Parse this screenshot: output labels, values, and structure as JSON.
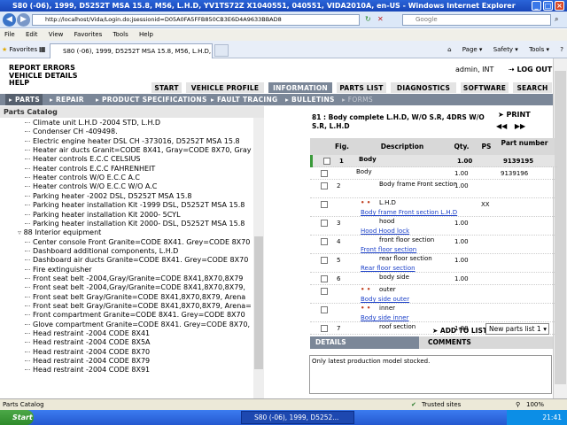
{
  "window": {
    "title": "S80 (-06), 1999, D5252T MSA 15.8, M56, L.H.D, YV1TS72Z X1040551, 040551, VIDA2010A, en-US - Windows Internet Explorer",
    "address": "http://localhost/Vida/Login.do;jsessionid=D05A0FA5FFB850CB3E6D4A9633BBAD8",
    "search_placeholder": "Google",
    "menu": [
      "File",
      "Edit",
      "View",
      "Favorites",
      "Tools",
      "Help"
    ],
    "favorites_label": "Favorites",
    "tab_title": "S80 (-06), 1999, D5252T MSA 15.8, M56, L.H.D, YV1...",
    "page_tools": [
      "Page ▾",
      "Safety ▾",
      "Tools ▾",
      "?"
    ]
  },
  "header": {
    "links": [
      "REPORT ERRORS",
      "VEHICLE DETAILS",
      "HELP"
    ],
    "user": "admin, INT",
    "logout": "LOG OUT"
  },
  "main_tabs": [
    "START",
    "VEHICLE PROFILE",
    "INFORMATION",
    "PARTS LIST",
    "DIAGNOSTICS",
    "SOFTWARE",
    "SEARCH"
  ],
  "sub_nav": [
    "PARTS",
    "REPAIR",
    "PRODUCT SPECIFICATIONS",
    "FAULT TRACING",
    "BULLETINS",
    "FORMS"
  ],
  "catalog": {
    "title": "Parts Catalog",
    "items": [
      {
        "text": "Climate unit L.H.D -2004 STD, L.H.D"
      },
      {
        "text": "Condenser CH -409498."
      },
      {
        "text": "Electric engine heater DSL CH -373016, D5252T MSA 15.8"
      },
      {
        "text": "Heater air ducts Granit=CODE 8X41, Gray=CODE 8X70, Gray"
      },
      {
        "text": "Heater controls E.C.C CELSIUS"
      },
      {
        "text": "Heater controls E.C.C FAHRENHEIT"
      },
      {
        "text": "Heater controls W/O E.C.C A.C"
      },
      {
        "text": "Heater controls W/O E.C.C W/O A.C"
      },
      {
        "text": "Parking heater -2002 DSL, D5252T MSA 15.8"
      },
      {
        "text": "Parking heater installation Kit -1999 DSL, D5252T MSA 15.8"
      },
      {
        "text": "Parking heater installation Kit 2000- 5CYL"
      },
      {
        "text": "Parking heater installation Kit 2000- DSL, D5252T MSA 15.8"
      },
      {
        "text": "88 Interior equipment",
        "group": true
      },
      {
        "text": "Center console Front Granite=CODE 8X41. Grey=CODE 8X70"
      },
      {
        "text": "Dashboard additional components, L.H.D"
      },
      {
        "text": "Dashboard air ducts Granite=CODE 8X41. Grey=CODE 8X70"
      },
      {
        "text": "Fire extinguisher"
      },
      {
        "text": "Front seat belt -2004,Gray/Granite=CODE 8X41,8X70,8X79"
      },
      {
        "text": "Front seat belt -2004,Gray/Granite=CODE 8X41,8X70,8X79,"
      },
      {
        "text": "Front seat belt Gray/Granite=CODE 8X41,8X70,8X79, Arena"
      },
      {
        "text": "Front seat belt Gray/Granite=CODE 8X41,8X70,8X79, Arena="
      },
      {
        "text": "Front compartment Granite=CODE 8X41. Grey=CODE 8X70"
      },
      {
        "text": "Glove compartment Granite=CODE 8X41. Grey=CODE 8X70,"
      },
      {
        "text": "Head restraint -2004 CODE 8X41"
      },
      {
        "text": "Head restraint -2004 CODE 8X5A"
      },
      {
        "text": "Head restraint -2004 CODE 8X70"
      },
      {
        "text": "Head restraint -2004 CODE 8X79"
      },
      {
        "text": "Head restraint -2004 CODE 8X91"
      }
    ]
  },
  "assembly": {
    "title": "81 : Body complete L.H.D, W/O S.R, 4DRS W/O S.R, L.H.D",
    "print": "PRINT"
  },
  "parts_table": {
    "headers": [
      "Fig.",
      "Description",
      "Qty.",
      "PS",
      "Part number"
    ],
    "rows": [
      {
        "fig": "1",
        "desc": "Body",
        "qty": "1.00",
        "ps": "",
        "pn": "9139195",
        "bold": true
      },
      {
        "fig": "",
        "desc": "Body",
        "qty": "1.00",
        "ps": "",
        "pn": "9139196"
      },
      {
        "fig": "2",
        "desc": "Body frame Front section",
        "qty": "1.00",
        "ps": "",
        "pn": ""
      },
      {
        "stars": "• •",
        "desc": "L.H.D",
        "qty": "",
        "ps": "XX",
        "pn": "",
        "link": "Body frame Front section L.H.D"
      },
      {
        "fig": "3",
        "desc": "hood",
        "qty": "1.00",
        "ps": "",
        "pn": "",
        "link": "Hood Hood lock"
      },
      {
        "fig": "4",
        "desc": "front floor section",
        "qty": "1.00",
        "ps": "",
        "pn": "",
        "link": "Front floor section"
      },
      {
        "fig": "5",
        "desc": "rear floor section",
        "qty": "1.00",
        "ps": "",
        "pn": "",
        "link": "Rear floor section"
      },
      {
        "fig": "6",
        "desc": "body side",
        "qty": "1.00",
        "ps": "",
        "pn": ""
      },
      {
        "stars": "• •",
        "desc": "outer",
        "qty": "",
        "ps": "",
        "pn": "",
        "link": "Body side outer"
      },
      {
        "stars": "• •",
        "desc": "inner",
        "qty": "",
        "ps": "",
        "pn": "",
        "link": "Body side inner"
      },
      {
        "fig": "7",
        "desc": "roof section",
        "qty": "1.00",
        "ps": "",
        "pn": ""
      }
    ]
  },
  "add_to_list": "ADD TO LIST",
  "new_parts_select": "New parts list 1",
  "details": {
    "tabs": [
      "DETAILS",
      "COMMENTS"
    ],
    "text": "Only latest production model stocked."
  },
  "statusbar": {
    "left": "Parts Catalog",
    "zone": "Trusted sites",
    "zoom": "100%"
  },
  "taskbar": {
    "start": "Start",
    "item": "S80 (-06), 1999, D5252...",
    "clock": "21:41"
  },
  "colors": {
    "titlebar": "#1846b8",
    "tab_active": "#7b8798",
    "link": "#1a3fc8",
    "stars": "#c04020"
  }
}
